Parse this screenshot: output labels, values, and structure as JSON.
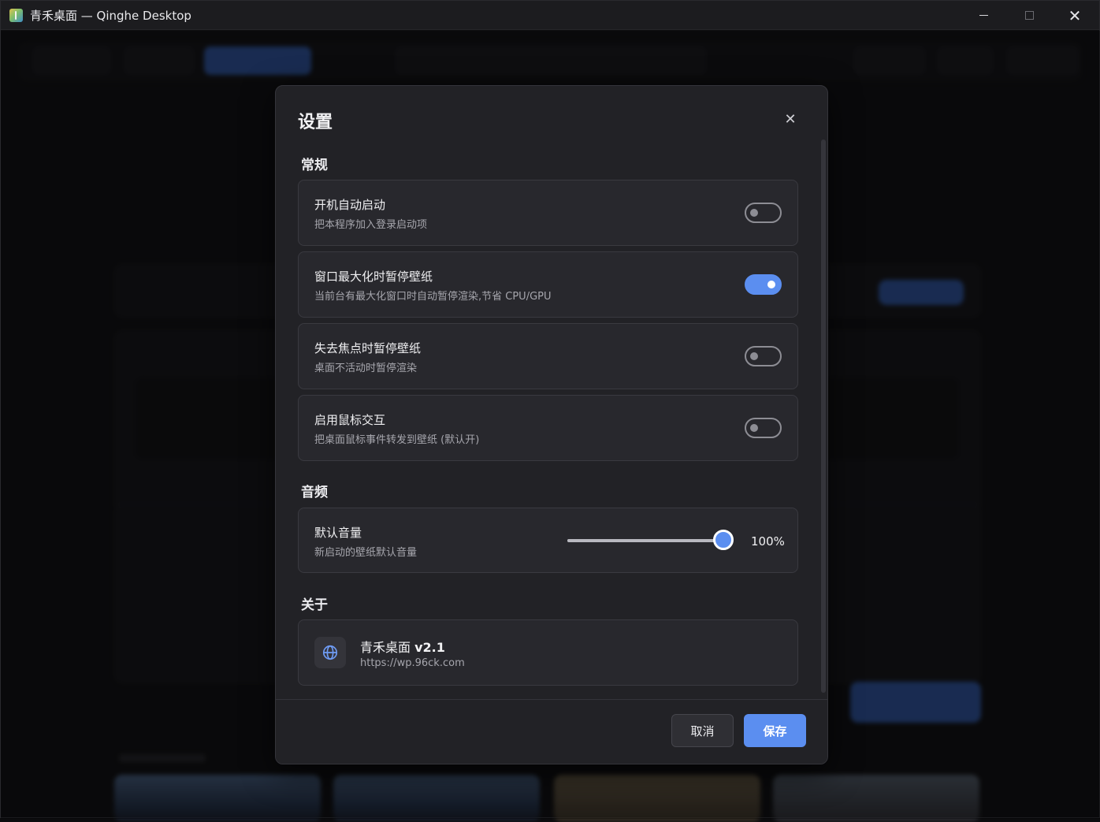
{
  "window": {
    "title": "青禾桌面 — Qinghe Desktop",
    "minimize_icon": "minimize-icon",
    "maximize_icon": "maximize-icon",
    "close_icon": "close-icon",
    "close_glyph": "✕"
  },
  "modal": {
    "title": "设置",
    "close_glyph": "✕",
    "sections": {
      "general": {
        "title": "常规",
        "items": [
          {
            "title": "开机自动启动",
            "subtitle": "把本程序加入登录启动项",
            "enabled": false
          },
          {
            "title": "窗口最大化时暂停壁纸",
            "subtitle": "当前台有最大化窗口时自动暂停渲染,节省 CPU/GPU",
            "enabled": true
          },
          {
            "title": "失去焦点时暂停壁纸",
            "subtitle": "桌面不活动时暂停渲染",
            "enabled": false
          },
          {
            "title": "启用鼠标交互",
            "subtitle": "把桌面鼠标事件转发到壁纸 (默认开)",
            "enabled": false
          }
        ]
      },
      "audio": {
        "title": "音频",
        "volume": {
          "title": "默认音量",
          "subtitle": "新启动的壁纸默认音量",
          "value": 100,
          "value_label": "100%"
        }
      },
      "about": {
        "title": "关于",
        "app_name": "青禾桌面",
        "version": "v2.1",
        "url": "https://wp.96ck.com",
        "icon": "globe-icon"
      }
    },
    "footer": {
      "cancel_label": "取消",
      "save_label": "保存"
    }
  },
  "colors": {
    "accent": "#5b8ef0",
    "modal_bg": "#222226",
    "card_bg": "#28282d"
  }
}
